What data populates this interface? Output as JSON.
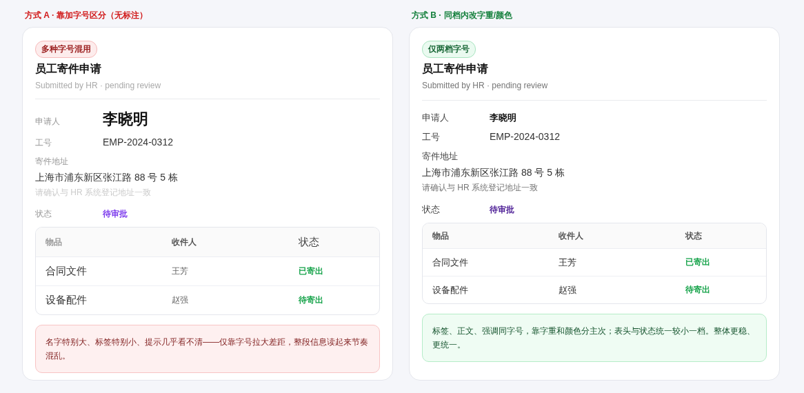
{
  "panels": [
    {
      "kind": "mixed",
      "heading": "方式 A · 靠加字号区分（无标注）",
      "badge": "多种字号混用",
      "title": "员工寄件申请",
      "subtitle": "Submitted by HR · pending review",
      "applicant": {
        "label": "申请人",
        "value": "李晓明"
      },
      "employee_id": {
        "label": "工号",
        "value": "EMP-2024-0312"
      },
      "address": {
        "label": "寄件地址",
        "value": "上海市浦东新区张江路 88 号 5 栋",
        "hint": "请确认与 HR 系统登记地址一致"
      },
      "status": {
        "label": "状态",
        "value": "待审批"
      },
      "table": {
        "columns": [
          "物品",
          "收件人",
          "状态"
        ],
        "rows": [
          {
            "item": "合同文件",
            "recipient": "王芳",
            "status": "已寄出"
          },
          {
            "item": "设备配件",
            "recipient": "赵强",
            "status": "待寄出"
          }
        ]
      },
      "note": "名字特别大、标签特别小、提示几乎看不清——仅靠字号拉大差距，整段信息读起来节奏混乱。"
    },
    {
      "kind": "uniform",
      "heading": "方式 B · 同档内改字重/颜色",
      "badge": "仅两档字号",
      "title": "员工寄件申请",
      "subtitle": "Submitted by HR · pending review",
      "applicant": {
        "label": "申请人",
        "value": "李晓明"
      },
      "employee_id": {
        "label": "工号",
        "value": "EMP-2024-0312"
      },
      "address": {
        "label": "寄件地址",
        "value": "上海市浦东新区张江路 88 号 5 栋",
        "hint": "请确认与 HR 系统登记地址一致"
      },
      "status": {
        "label": "状态",
        "value": "待审批"
      },
      "table": {
        "columns": [
          "物品",
          "收件人",
          "状态"
        ],
        "rows": [
          {
            "item": "合同文件",
            "recipient": "王芳",
            "status": "已寄出"
          },
          {
            "item": "设备配件",
            "recipient": "赵强",
            "status": "待寄出"
          }
        ]
      },
      "note": "标签、正文、强调同字号，靠字重和颜色分主次；表头与状态统一较小一档。整体更稳、更统一。"
    }
  ]
}
